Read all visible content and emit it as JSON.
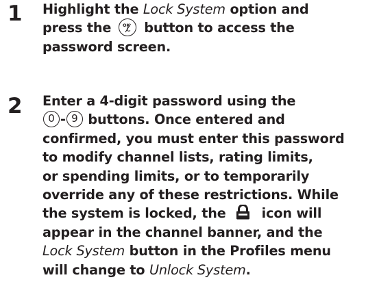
{
  "steps": [
    {
      "number": "1",
      "lines": [
        [
          "Highlight the ",
          {
            "em": "Lock System"
          },
          " option and"
        ],
        [
          "press the ",
          {
            "icon": "ok-button-icon"
          },
          " button to access the"
        ],
        [
          "password screen."
        ]
      ]
    },
    {
      "number": "2",
      "lines": [
        [
          "Enter a 4-digit password using the"
        ],
        [
          {
            "digit": "0"
          },
          "-",
          {
            "digit": "9"
          },
          " buttons. Once entered and"
        ],
        [
          "confirmed, you must enter this password"
        ],
        [
          "to modify channel lists, rating limits,"
        ],
        [
          "or spending limits, or to temporarily"
        ],
        [
          "override any of these restrictions. While"
        ],
        [
          "the system is locked, the ",
          {
            "icon": "lock-icon"
          },
          " icon will"
        ],
        [
          "appear in the channel banner, and the"
        ],
        [
          {
            "em": "Lock System"
          },
          " button in the Profiles menu"
        ],
        [
          "will change to ",
          {
            "em": "Unlock System"
          },
          "."
        ]
      ]
    }
  ]
}
